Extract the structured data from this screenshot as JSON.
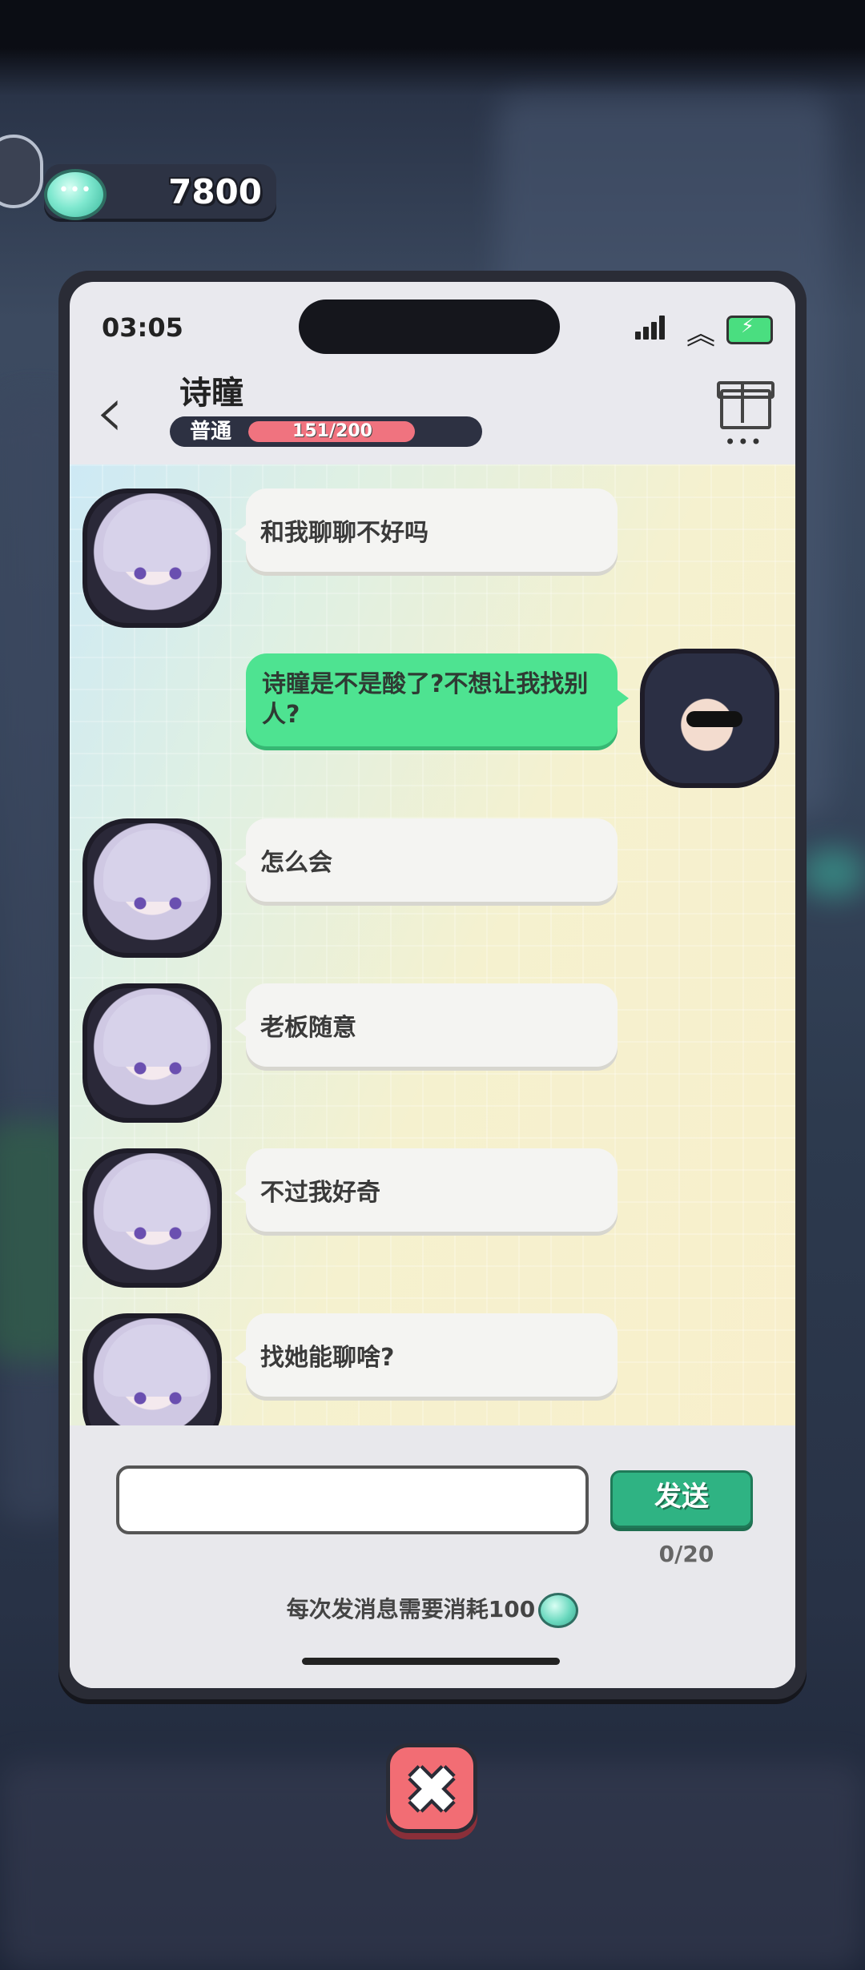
{
  "currency": {
    "amount": "7800",
    "icon": "gem-icon"
  },
  "status_bar": {
    "time": "03:05"
  },
  "header": {
    "name": "诗瞳",
    "rank_label": "普通",
    "progress_text": "151/200",
    "progress": 0.755
  },
  "messages": [
    {
      "side": "left",
      "text": "和我聊聊不好吗"
    },
    {
      "side": "right",
      "text": "诗瞳是不是酸了?不想让我找别人?"
    },
    {
      "side": "left",
      "text": "怎么会"
    },
    {
      "side": "left",
      "text": "老板随意"
    },
    {
      "side": "left",
      "text": "不过我好奇"
    },
    {
      "side": "left",
      "text": "找她能聊啥?"
    }
  ],
  "input": {
    "value": "",
    "placeholder": ""
  },
  "send_button": {
    "label": "发送"
  },
  "char_counter": "0/20",
  "cost_note": "每次发消息需要消耗100",
  "colors": {
    "send": "#2fb383",
    "bubble_self": "#4ee391",
    "close": "#f26d74",
    "rank_fill": "#f0737f"
  }
}
